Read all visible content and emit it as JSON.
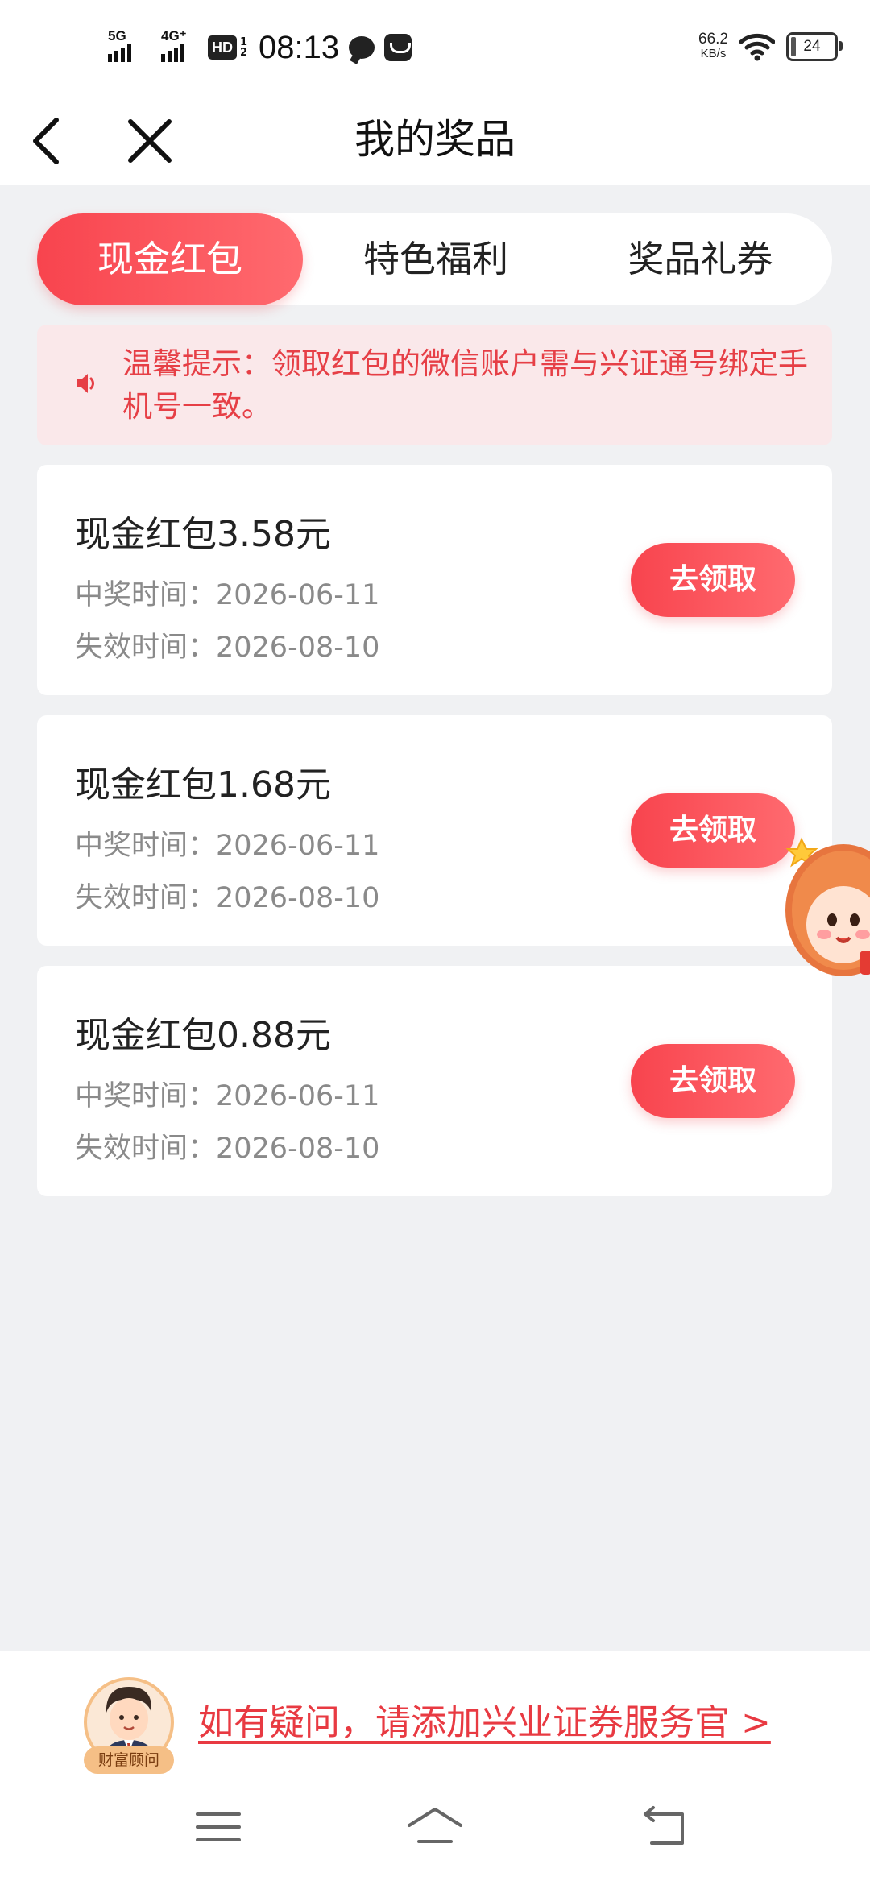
{
  "status_bar": {
    "sim1_label": "5G",
    "sim2_label": "4G⁺",
    "hd_label": "HD",
    "hd_sub": "1\n2",
    "time": "08:13",
    "net_speed_value": "66.2",
    "net_speed_unit": "KB/s",
    "battery_level": "24"
  },
  "header": {
    "title": "我的奖品"
  },
  "tabs": [
    {
      "label": "现金红包",
      "active": true
    },
    {
      "label": "特色福利",
      "active": false
    },
    {
      "label": "奖品礼券",
      "active": false
    }
  ],
  "notice": {
    "text": "温馨提示：领取红包的微信账户需与兴证通号绑定手机号一致。"
  },
  "prizes": [
    {
      "title": "现金红包3.58元",
      "win_time": "中奖时间：2026-06-11",
      "expire_time": "失效时间：2026-08-10",
      "button": "去领取"
    },
    {
      "title": "现金红包1.68元",
      "win_time": "中奖时间：2026-06-11",
      "expire_time": "失效时间：2026-08-10",
      "button": "去领取"
    },
    {
      "title": "现金红包0.88元",
      "win_time": "中奖时间：2026-06-11",
      "expire_time": "失效时间：2026-08-10",
      "button": "去领取"
    }
  ],
  "footer": {
    "advisor_badge": "财富顾问",
    "link_text": "如有疑问，请添加兴业证券服务官 >"
  },
  "nav_bar": {
    "icons": [
      "menu-icon",
      "home-icon",
      "back-icon"
    ]
  },
  "colors": {
    "accent": "#f8444e",
    "notice_bg": "#fae8ea",
    "page_bg": "#f0f1f3"
  }
}
